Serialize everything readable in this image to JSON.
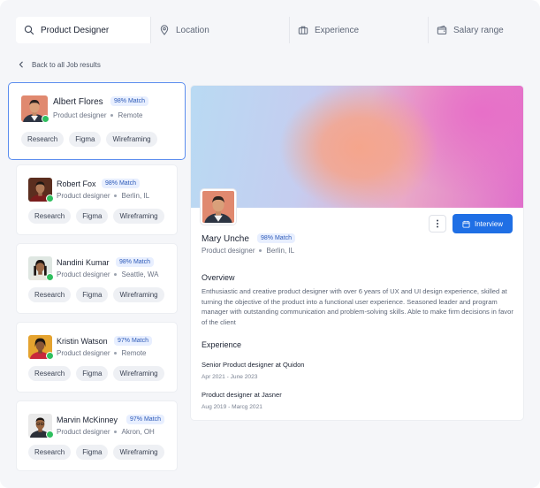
{
  "search": {
    "fields": [
      {
        "label": "Product Designer",
        "icon": "search-icon"
      },
      {
        "label": "Location",
        "icon": "location-pin-icon"
      },
      {
        "label": "Experience",
        "icon": "briefcase-icon"
      },
      {
        "label": "Salary range",
        "icon": "wallet-icon"
      }
    ]
  },
  "back_link": "Back to all Job results",
  "candidates": [
    {
      "name": "Albert Flores",
      "match": "98% Match",
      "role": "Product designer",
      "location": "Remote",
      "tags": [
        "Research",
        "Figma",
        "Wireframing"
      ],
      "online": true,
      "selected": true
    },
    {
      "name": "Robert Fox",
      "match": "98% Match",
      "role": "Product designer",
      "location": "Berlin, IL",
      "tags": [
        "Research",
        "Figma",
        "Wireframing"
      ],
      "online": true
    },
    {
      "name": "Nandini Kumar",
      "match": "98% Match",
      "role": "Product designer",
      "location": "Seattle, WA",
      "tags": [
        "Research",
        "Figma",
        "Wireframing"
      ],
      "online": true
    },
    {
      "name": "Kristin Watson",
      "match": "97% Match",
      "role": "Product designer",
      "location": "Remote",
      "tags": [
        "Research",
        "Figma",
        "Wireframing"
      ],
      "online": true
    },
    {
      "name": "Marvin McKinney",
      "match": "97% Match",
      "role": "Product designer",
      "location": "Akron, OH",
      "tags": [
        "Research",
        "Figma",
        "Wireframing"
      ],
      "online": true
    }
  ],
  "profile": {
    "name": "Mary Unche",
    "match": "98% Match",
    "role": "Product designer",
    "location": "Berlin, IL",
    "interview_label": "Interview",
    "overview_heading": "Overview",
    "overview_text": "Enthusiastic and creative product designer with over 6 years of UX and UI design experience, skilled at turning the objective of the product into a functional user experience. Seasoned leader and program manager with outstanding communication and problem-solving skills. Able to make firm decisions in favor of the client",
    "experience_heading": "Experience",
    "experience": [
      {
        "title": "Senior Product designer at Quidon",
        "dates": "Apr 2021 - June 2023"
      },
      {
        "title": "Product designer at Jasner",
        "dates": "Aug 2019 - Marcg 2021"
      }
    ]
  },
  "colors": {
    "accent": "#1f6fe5",
    "match_bg": "#e8efff",
    "online": "#2fbf5f",
    "active_border": "#5b8def"
  }
}
